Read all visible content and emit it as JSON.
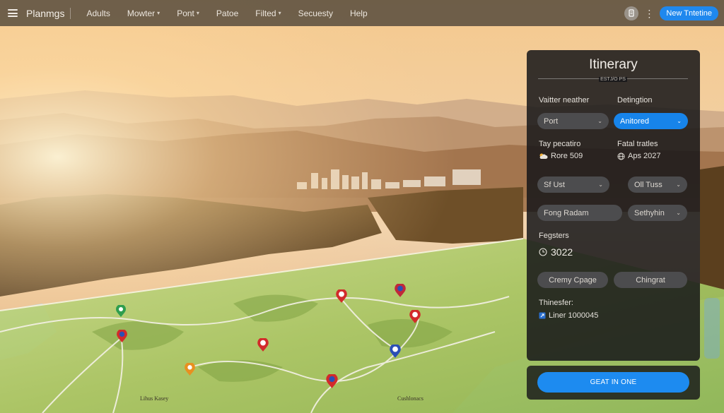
{
  "app": {
    "title": "Planmgs"
  },
  "nav": {
    "items": [
      {
        "label": "Adults",
        "dropdown": false
      },
      {
        "label": "Mowter",
        "dropdown": true
      },
      {
        "label": "Pont",
        "dropdown": true
      },
      {
        "label": "Patoe",
        "dropdown": false
      },
      {
        "label": "Filted",
        "dropdown": true
      },
      {
        "label": "Secuesty",
        "dropdown": false
      },
      {
        "label": "Help",
        "dropdown": false
      }
    ],
    "new_button": "New Tntetine"
  },
  "icons": {
    "menu": "hamburger-icon",
    "profile": "profile-icon",
    "more": "kebab-icon",
    "weather": "cloud-sun-icon",
    "globe": "globe-icon",
    "clock": "clock-icon",
    "transfer": "transfer-icon",
    "pin": "map-pin-icon"
  },
  "panel": {
    "title": "Itinerary",
    "subtitle": "ESTJ/O PS",
    "weather_label": "Vaitter neather",
    "destination_label": "Detingtion",
    "weather_select": "Port",
    "destination_select": "Anitored",
    "tay_label": "Tay pecatiro",
    "fatal_label": "Fatal tratles",
    "tay_value": "Rore 509",
    "fatal_value": "Aps 2027",
    "field_a": "Sf Ust",
    "field_b": "Oll Tuss",
    "field_c": "Fong Radam",
    "field_d": "Sethyhin",
    "registers_label": "Fegsters",
    "registers_value": "3022",
    "button_a": "Cremy Cpage",
    "button_b": "Chingrat",
    "transfer_label": "Thinesfer:",
    "transfer_value": "Liner 1000045",
    "cta": "GEAT IN ONE"
  },
  "map": {
    "labels": [
      "Lihus Kasey",
      "Cushlonacs"
    ]
  },
  "colors": {
    "accent": "#1d8bf0",
    "panel_bg": "#161618",
    "field_bg": "#4c4c4e",
    "pin_red": "#d22a2a",
    "pin_green": "#2f9e4e",
    "pin_orange": "#e89020",
    "pin_blue": "#2b4fb5"
  }
}
